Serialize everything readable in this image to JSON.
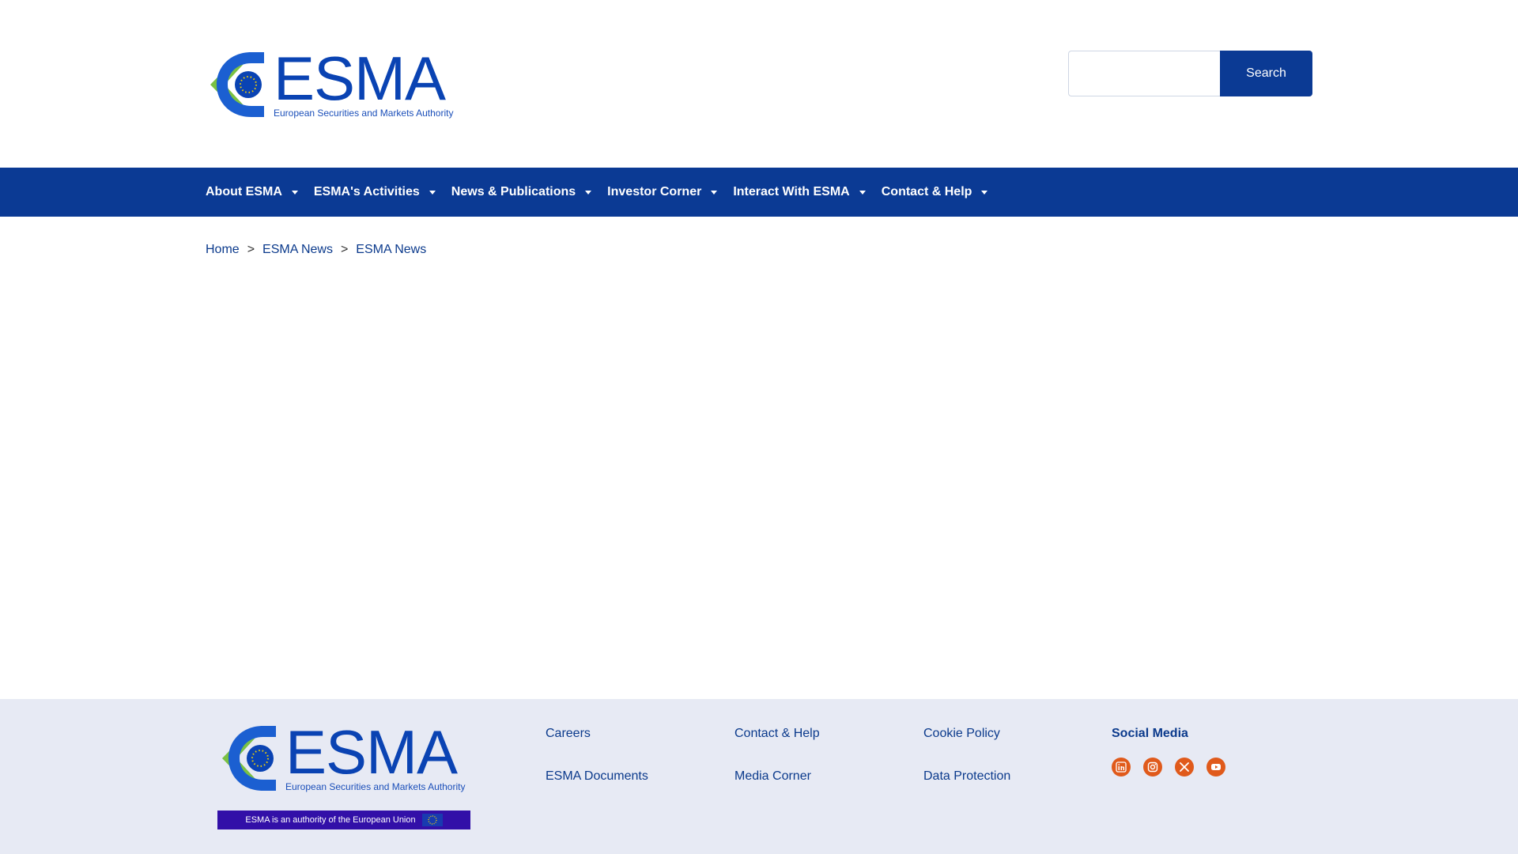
{
  "header": {
    "logo": {
      "word": "ESMA",
      "subtitle": "European Securities and Markets Authority"
    },
    "search": {
      "input_value": "",
      "placeholder": "",
      "button_label": "Search"
    }
  },
  "nav": {
    "items": [
      {
        "label": "About ESMA"
      },
      {
        "label": "ESMA's Activities"
      },
      {
        "label": "News & Publications"
      },
      {
        "label": "Investor Corner"
      },
      {
        "label": "Interact With ESMA"
      },
      {
        "label": "Contact & Help"
      }
    ]
  },
  "breadcrumb": {
    "items": [
      "Home",
      "ESMA News",
      "ESMA News"
    ],
    "separator": ">"
  },
  "footer": {
    "logo": {
      "word": "ESMA",
      "subtitle": "European Securities and Markets Authority"
    },
    "eu_band": "ESMA is an authority of the European Union",
    "columns": [
      {
        "links": [
          "Careers",
          "ESMA Documents"
        ]
      },
      {
        "links": [
          "Contact & Help",
          "Media Corner"
        ]
      },
      {
        "links": [
          "Cookie Policy",
          "Data Protection"
        ]
      }
    ],
    "social": {
      "title": "Social Media",
      "icons": [
        "linkedin-icon",
        "instagram-icon",
        "x-icon",
        "youtube-icon"
      ]
    }
  },
  "colors": {
    "brand_blue": "#0b3a94",
    "logo_blue": "#0a43b3",
    "logo_green": "#7ac143",
    "footer_bg": "#e7eaf4",
    "eu_band": "#3210a8",
    "social_orange": "#e05a1b"
  }
}
